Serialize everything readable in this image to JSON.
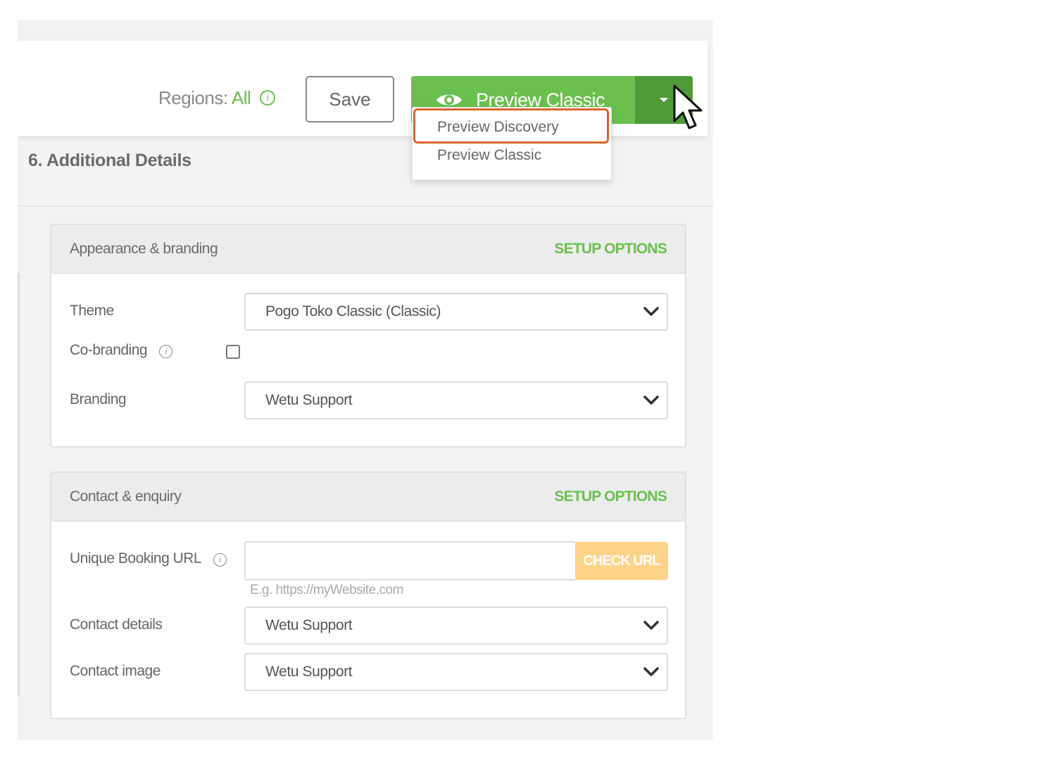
{
  "header": {
    "regions_label": "Regions:",
    "regions_value": "All",
    "save_label": "Save",
    "preview_label": "Preview Classic",
    "dropdown": {
      "items": [
        "Preview Discovery",
        "Preview Classic"
      ],
      "highlighted_item": "Preview Discovery"
    }
  },
  "page": {
    "section_title": "6. Additional Details"
  },
  "appearance": {
    "title": "Appearance & branding",
    "setup": "SETUP OPTIONS",
    "theme_label": "Theme",
    "theme_value": "Pogo Toko Classic (Classic)",
    "cobranding_label": "Co-branding",
    "cobranding_checked": false,
    "branding_label": "Branding",
    "branding_value": "Wetu Support"
  },
  "contact": {
    "title": "Contact & enquiry",
    "setup": "SETUP OPTIONS",
    "booking_url_label": "Unique Booking URL",
    "booking_url_value": "",
    "check_url_label": "CHECK URL",
    "booking_url_hint": "E.g. https://myWebsite.com",
    "contact_details_label": "Contact details",
    "contact_details_value": "Wetu Support",
    "contact_image_label": "Contact image",
    "contact_image_value": "Wetu Support"
  },
  "colors": {
    "accent_green": "#6bbf4e",
    "split_green": "#4f9a37",
    "highlight_orange": "#d9652b",
    "check_url_bg": "#fdd38a"
  },
  "icons": [
    "info-icon",
    "eye-icon",
    "caret-down-icon",
    "chevron-down-icon",
    "cursor-arrow-icon"
  ]
}
